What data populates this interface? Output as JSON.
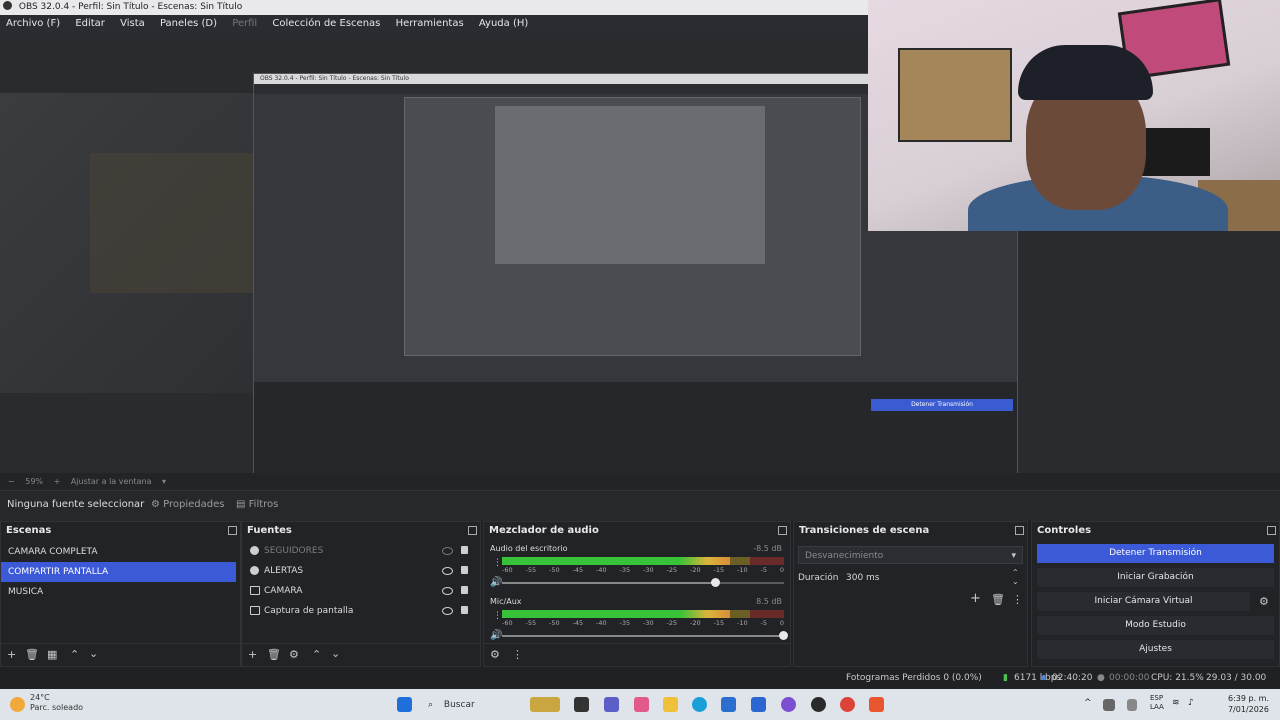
{
  "window": {
    "title": "OBS 32.0.4 - Perfil: Sin Título - Escenas: Sin Título"
  },
  "menu": {
    "items": [
      "Archivo (F)",
      "Editar",
      "Vista",
      "Paneles (D)",
      "Perfil",
      "Colección de Escenas",
      "Herramientas",
      "Ayuda (H)"
    ]
  },
  "nested_preview": {
    "title": "OBS 32.0.4 - Perfil: Sin Título - Escenas: Sin Título",
    "button": "Detener Transmisión"
  },
  "zoom": {
    "percent": "59%",
    "fit_label": "Ajustar a la ventana"
  },
  "context_bar": {
    "no_source": "Ninguna fuente seleccionar",
    "properties": "Propiedades",
    "filters": "Filtros"
  },
  "scenes": {
    "title": "Escenas",
    "items": [
      {
        "label": "CAMARA COMPLETA",
        "active": false
      },
      {
        "label": "COMPARTIR PANTALLA",
        "active": true
      },
      {
        "label": "MUSICA",
        "active": false
      }
    ]
  },
  "sources": {
    "title": "Fuentes",
    "items": [
      {
        "label": "SEGUIDORES",
        "icon": "globe-icon",
        "hidden": true
      },
      {
        "label": "ALERTAS",
        "icon": "globe-icon",
        "hidden": false
      },
      {
        "label": "CAMARA",
        "icon": "camera-icon",
        "hidden": false
      },
      {
        "label": "Captura de pantalla",
        "icon": "monitor-icon",
        "hidden": false
      }
    ]
  },
  "mixer": {
    "title": "Mezclador de audio",
    "channels": [
      {
        "name": "Audio del escritorio",
        "db": "-8.5 dB",
        "level": 0.81,
        "volume": 0.76
      },
      {
        "name": "Mic/Aux",
        "db": "8.5 dB",
        "level": 0.81,
        "volume": 1.0
      }
    ],
    "ticks": [
      "-60",
      "-55",
      "-50",
      "-45",
      "-40",
      "-35",
      "-30",
      "-25",
      "-20",
      "-15",
      "-10",
      "-5",
      "0"
    ]
  },
  "transitions": {
    "title": "Transiciones de escena",
    "selected": "Desvanecimiento",
    "duration_label": "Duración",
    "duration_value": "300 ms"
  },
  "controls": {
    "title": "Controles",
    "buttons": [
      "Detener Transmisión",
      "Iniciar Grabación",
      "Iniciar Cámara Virtual",
      "Modo Estudio",
      "Ajustes"
    ]
  },
  "status": {
    "dropped_frames": "Fotogramas Perdidos 0 (0.0%)",
    "bitrate": "6171 kbps",
    "stream_time": "02:40:20",
    "record_time": "00:00:00",
    "cpu": "CPU: 21.5%",
    "fps": "29.03 / 30.00 FPS"
  },
  "taskbar": {
    "weather_temp": "24°C",
    "weather_desc": "Parc. soleado",
    "search": "Buscar",
    "lang_top": "ESP",
    "lang_bottom": "LAA",
    "time": "6:39 p. m.",
    "date": "7/01/2026"
  },
  "colors": {
    "accent": "#3c5ad8",
    "meter_green": "#38c238",
    "meter_yellow": "#d9b43a"
  }
}
